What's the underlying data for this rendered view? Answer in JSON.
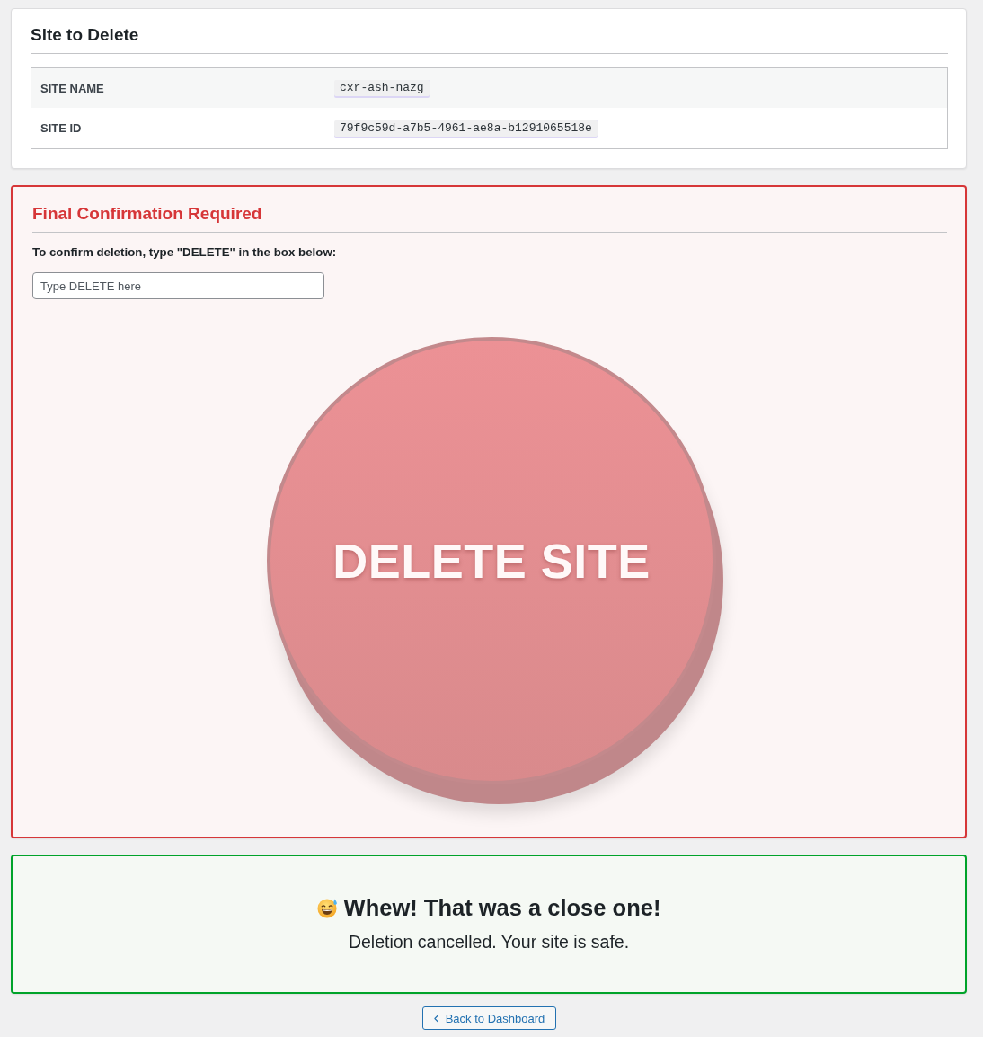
{
  "site_card": {
    "title": "Site to Delete",
    "rows": [
      {
        "label": "SITE NAME",
        "value": "cxr-ash-nazg"
      },
      {
        "label": "SITE ID",
        "value": "79f9c59d-a7b5-4961-ae8a-b1291065518e"
      }
    ]
  },
  "confirmation": {
    "title": "Final Confirmation Required",
    "instruction": "To confirm deletion, type \"DELETE\" in the box below:",
    "input": {
      "placeholder": "Type DELETE here"
    },
    "delete_button": {
      "label": "DELETE SITE",
      "disabled": true
    }
  },
  "result": {
    "title": "Whew! That was a close one!",
    "message": "Deletion cancelled. Your site is safe."
  },
  "back_button": {
    "label": "Back to Dashboard"
  }
}
